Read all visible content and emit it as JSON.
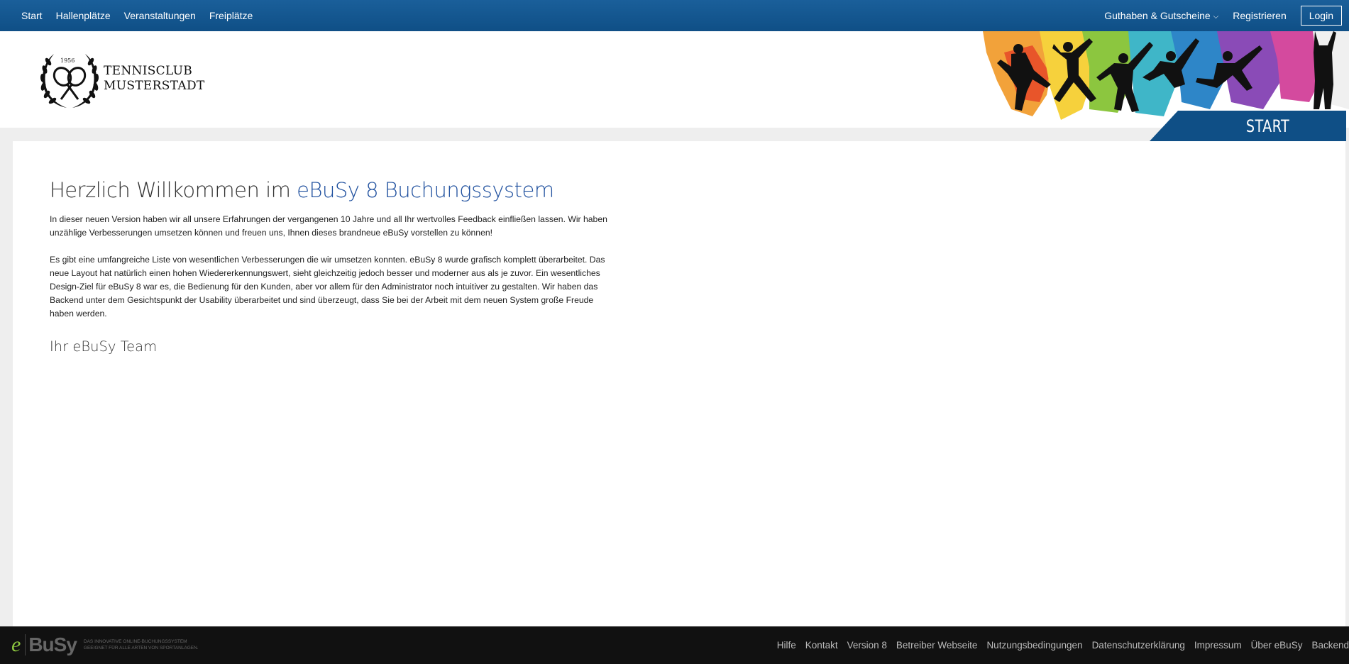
{
  "nav": {
    "left": [
      "Start",
      "Hallenplätze",
      "Veranstaltungen",
      "Freiplätze"
    ],
    "vouchers": "Guthaben & Gutscheine",
    "register": "Registrieren",
    "login": "Login"
  },
  "header": {
    "logo_line1": "TENNISCLUB",
    "logo_line2": "MUSTERSTADT",
    "logo_year": "1956",
    "section_tab": "START"
  },
  "content": {
    "headline_plain": "Herzlich Willkommen im ",
    "headline_accent": "eBuSy 8 Buchungssystem",
    "paragraph1": "In dieser neuen Version haben wir all unsere Erfahrungen der vergangenen 10 Jahre und all Ihr wertvolles Feedback einfließen lassen. Wir haben unzählige Verbesserungen umsetzen können und freuen uns, Ihnen dieses brandneue eBuSy vorstellen zu können!",
    "paragraph2": "Es gibt eine umfangreiche Liste von wesentlichen Verbesserungen die wir umsetzen konnten. eBuSy 8 wurde grafisch komplett überarbeitet. Das neue Layout hat natürlich einen hohen Wiedererkennungswert, sieht gleichzeitig jedoch besser und moderner aus als je zuvor. Ein wesentliches Design-Ziel für eBuSy 8 war es, die Bedienung für den Kunden, aber vor allem für den Administrator noch intuitiver zu gestalten. Wir haben das Backend unter dem Gesichtspunkt der Usability überarbeitet und sind überzeugt, dass Sie bei der Arbeit mit dem neuen System große Freude haben werden.",
    "signoff": "Ihr eBuSy Team"
  },
  "footer": {
    "brand_e": "e",
    "brand_rest": "BuSy",
    "tagline1": "Das innovative Online-Buchungssystem",
    "tagline2": "Geeignet für alle Arten von Sportanlagen.",
    "links": [
      "Hilfe",
      "Kontakt",
      "Version 8",
      "Betreiber Webseite",
      "Nutzungsbedingungen",
      "Datenschutzerklärung",
      "Impressum",
      "Über eBuSy",
      "Backend"
    ]
  },
  "colors": {
    "nav_bg": "#0f4f86",
    "accent": "#1e4f9e",
    "footer_bg": "#111111"
  }
}
